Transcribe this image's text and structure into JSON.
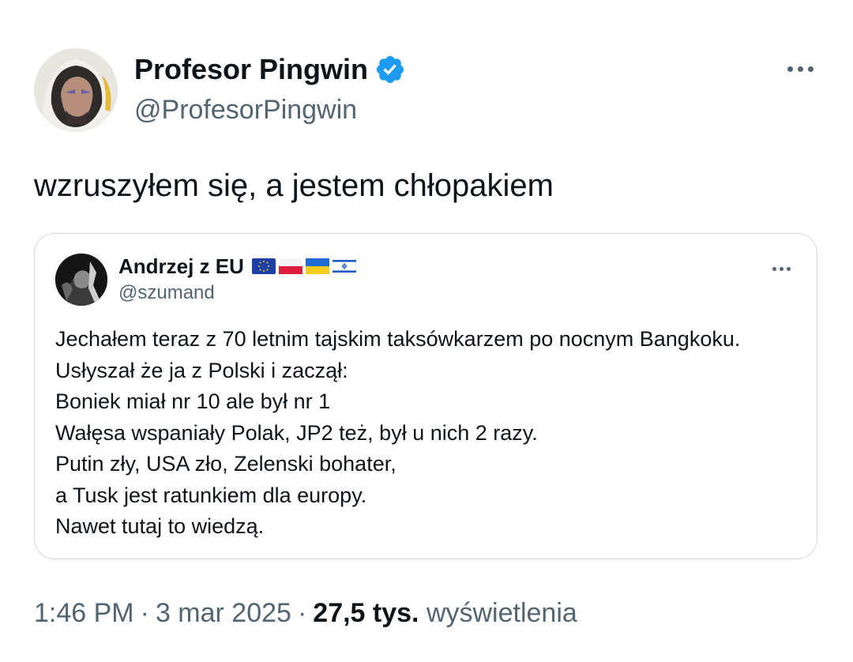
{
  "tweet": {
    "author": {
      "name": "Profesor Pingwin",
      "handle": "@ProfesorPingwin",
      "verified": true,
      "verified_color": "#1d9bf0"
    },
    "text": "wzruszyłem się, a jestem chłopakiem",
    "quote": {
      "author": {
        "name": "Andrzej z EU",
        "handle": "@szumand",
        "flags": [
          "eu-flag-icon",
          "poland-flag-icon",
          "ukraine-flag-icon",
          "israel-flag-icon"
        ]
      },
      "lines": [
        "Jechałem teraz z 70 letnim tajskim taksówkarzem po nocnym Bangkoku.",
        "Usłyszał że ja z Polski i zaczął:",
        "Boniek miał nr 10 ale był nr 1",
        "Wałęsa wspaniały Polak, JP2 też, był u nich 2 razy.",
        "Putin zły, USA zło, Zelenski bohater,",
        "a Tusk jest ratunkiem dla europy.",
        "Nawet tutaj to wiedzą."
      ]
    },
    "meta": {
      "time": "1:46 PM",
      "separator": "·",
      "date": "3 mar 2025",
      "views_count": "27,5 tys.",
      "views_label": "wyświetlenia"
    }
  }
}
